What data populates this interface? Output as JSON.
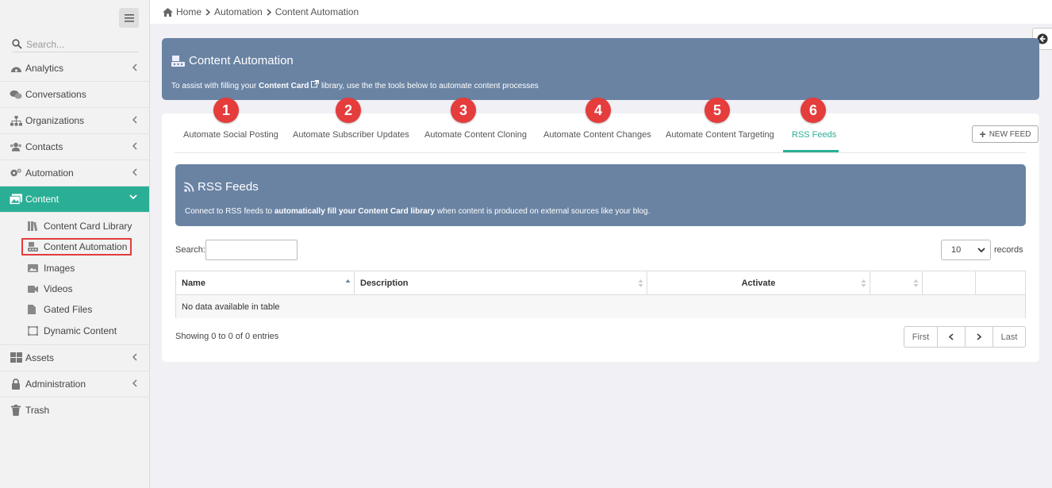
{
  "sidebar": {
    "search_placeholder": "Search...",
    "items": [
      {
        "label": "Analytics"
      },
      {
        "label": "Conversations"
      },
      {
        "label": "Organizations"
      },
      {
        "label": "Contacts"
      },
      {
        "label": "Automation"
      },
      {
        "label": "Content"
      },
      {
        "label": "Assets"
      },
      {
        "label": "Administration"
      },
      {
        "label": "Trash"
      }
    ],
    "content_sub": [
      {
        "label": "Content Card Library"
      },
      {
        "label": "Content Automation"
      },
      {
        "label": "Images"
      },
      {
        "label": "Videos"
      },
      {
        "label": "Gated Files"
      },
      {
        "label": "Dynamic Content"
      }
    ]
  },
  "breadcrumb": {
    "home": "Home",
    "level1": "Automation",
    "level2": "Content Automation"
  },
  "header": {
    "title": "Content Automation",
    "desc_pre": "To assist with filling your ",
    "desc_bold": "Content Card",
    "desc_post": " library, use the the tools below to automate content processes"
  },
  "tabs": [
    {
      "label": "Automate Social Posting",
      "badge": "1"
    },
    {
      "label": "Automate Subscriber Updates",
      "badge": "2"
    },
    {
      "label": "Automate Content Cloning",
      "badge": "3"
    },
    {
      "label": "Automate Content Changes",
      "badge": "4"
    },
    {
      "label": "Automate Content Targeting",
      "badge": "5"
    },
    {
      "label": "RSS Feeds",
      "badge": "6"
    }
  ],
  "new_feed_label": "NEW FEED",
  "rss": {
    "title": "RSS Feeds",
    "desc_pre": "Connect to RSS feeds to ",
    "desc_bold": "automatically fill your Content Card library",
    "desc_post": " when content is produced on external sources like your blog."
  },
  "table": {
    "search_label": "Search:",
    "records_value": "10",
    "records_label": "records",
    "columns": [
      "Name",
      "Description",
      "Activate"
    ],
    "empty_text": "No data available in table",
    "showing": "Showing 0 to 0 of 0 entries"
  },
  "pager": {
    "first": "First",
    "last": "Last"
  },
  "colors": {
    "accent": "#2aaf96",
    "banner": "#6a83a3",
    "badge": "#e53c3c"
  }
}
